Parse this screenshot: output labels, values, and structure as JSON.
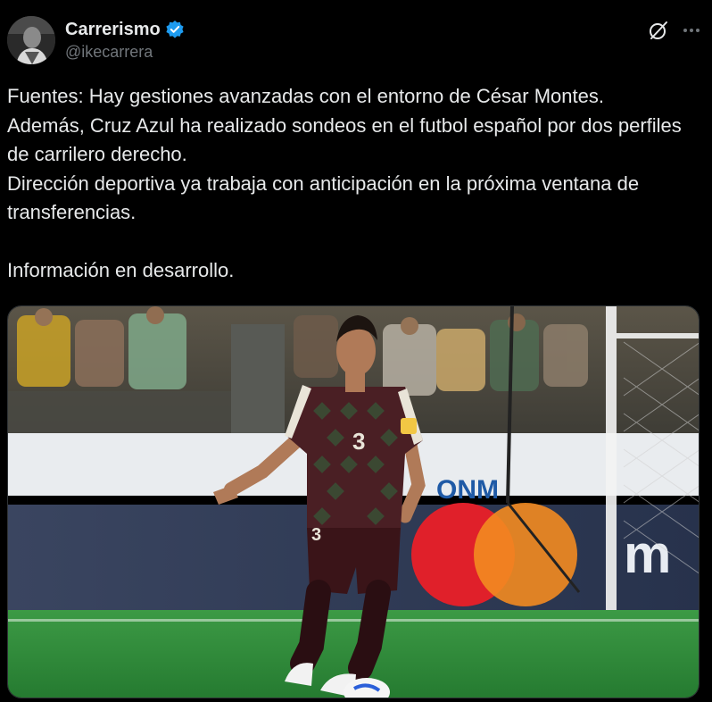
{
  "author": {
    "display_name": "Carrerismo",
    "handle": "@ikecarrera",
    "verified": true,
    "avatar_icon": "avatar-photo"
  },
  "actions": {
    "grok_icon": "grok-icon",
    "more_icon": "more-icon"
  },
  "tweet": {
    "text": "Fuentes: Hay gestiones avanzadas con el entorno de César Montes.\nAdemás, Cruz Azul ha realizado sondeos en el futbol español por dos perfiles de carrilero derecho.\nDirección deportiva ya trabaja con anticipación en la próxima ventana de transferencias.\n\nInformación en desarrollo."
  },
  "media": {
    "type": "photo",
    "jersey_number": "3",
    "board_text": "ONM"
  },
  "colors": {
    "background": "#000000",
    "text": "#e7e9ea",
    "muted": "#71767b",
    "verified": "#1d9bf0",
    "pitch": "#2f8a3a",
    "jersey": "#4a1f24"
  }
}
